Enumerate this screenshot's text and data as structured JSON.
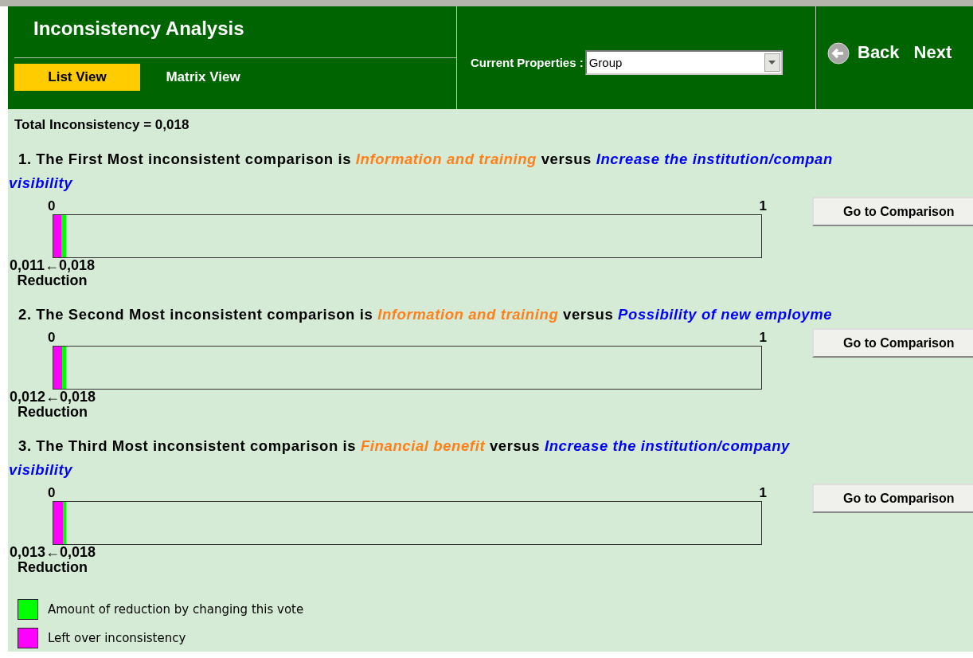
{
  "header": {
    "title": "Inconsistency Analysis",
    "tabs": [
      {
        "label": "List View",
        "selected": true
      },
      {
        "label": "Matrix View",
        "selected": false
      }
    ],
    "properties_label": "Current Properties :",
    "properties_value": "Group",
    "nav": [
      "Back",
      "Next"
    ]
  },
  "total": "Total Inconsistency = 0,018",
  "comparisons": [
    {
      "lead": "1. The First Most inconsistent comparison is",
      "item_a": "Information and training",
      "versus": "versus",
      "item_b": "Increase the institution/compan",
      "continuation": "visibility",
      "min_label": "0",
      "max_label": "1",
      "segments": [
        {
          "color": "#ff00ff",
          "level": 0.011
        },
        {
          "color": "#00ff00",
          "level": 0.007
        }
      ],
      "reading": "0,011←0,018",
      "caption": "Reduction",
      "button": "Go to Comparison"
    },
    {
      "lead": "2. The Second Most inconsistent comparison is",
      "item_a": "Information and training",
      "versus": "versus",
      "item_b": "Possibility of new employme",
      "min_label": "0",
      "max_label": "1",
      "segments": [
        {
          "color": "#ff00ff",
          "level": 0.012
        },
        {
          "color": "#00ff00",
          "level": 0.006
        }
      ],
      "reading": "0,012←0,018",
      "caption": "Reduction",
      "button": "Go to Comparison"
    },
    {
      "lead": "3. The Third Most inconsistent comparison is",
      "item_a": "Financial benefit",
      "versus": "versus",
      "item_b": "Increase the institution/company",
      "continuation": "visibility",
      "min_label": "0",
      "max_label": "1",
      "segments": [
        {
          "color": "#ff00ff",
          "level": 0.013
        },
        {
          "color": "#00ff00",
          "level": 0.005
        }
      ],
      "reading": "0,013←0,018",
      "caption": "Reduction",
      "button": "Go to Comparison"
    }
  ],
  "legend": [
    {
      "color": "#00ff00",
      "label": "Amount of reduction by changing this vote"
    },
    {
      "color": "#ff00ff",
      "label": "Left over inconsistency"
    }
  ]
}
